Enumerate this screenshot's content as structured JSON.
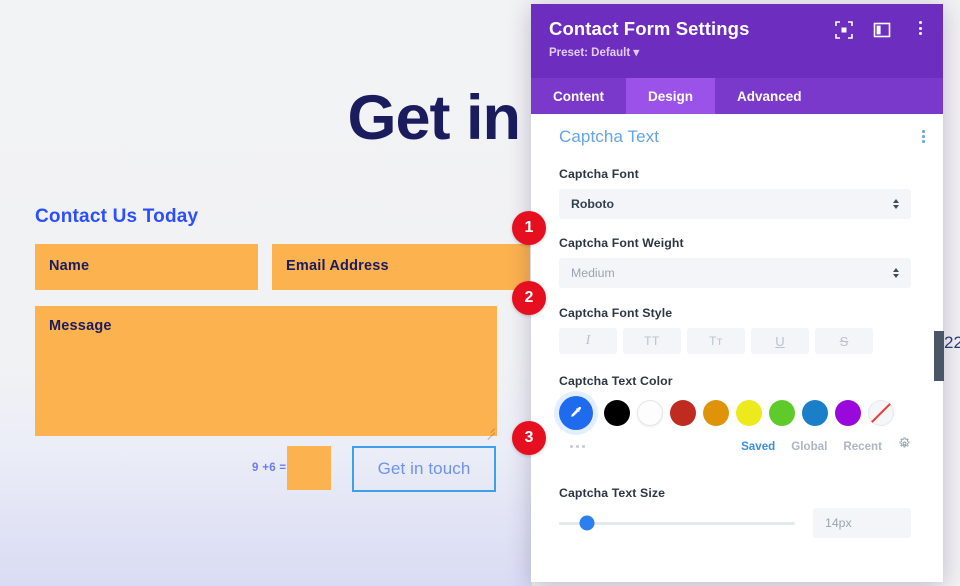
{
  "preview": {
    "hero_heading": "Get in",
    "form_title": "Contact Us Today",
    "fields": {
      "name": "Name",
      "email": "Email Address",
      "message": "Message"
    },
    "captcha": {
      "question": "9 +6 =",
      "answer_value": ""
    },
    "submit_label": "Get in touch",
    "colors": {
      "heading": "#1b1c5e",
      "form_title": "#2b4eff",
      "field_bg": "#fcb24f",
      "captcha_text": "#6b7bf0",
      "button_border": "#3da0e8",
      "button_text": "#6d93ef"
    }
  },
  "settings": {
    "title": "Contact Form Settings",
    "preset": "Preset: Default",
    "header_icons": [
      "focus-icon",
      "layout-icon",
      "more-vertical-icon"
    ],
    "tabs": [
      {
        "label": "Content",
        "active": false
      },
      {
        "label": "Design",
        "active": true
      },
      {
        "label": "Advanced",
        "active": false
      }
    ],
    "section": {
      "heading": "Captcha Text",
      "menu_icon": "more-vertical-icon"
    },
    "font": {
      "label": "Captcha Font",
      "value": "Roboto"
    },
    "font_weight": {
      "label": "Captcha Font Weight",
      "value": "Medium"
    },
    "font_style": {
      "label": "Captcha Font Style",
      "buttons": [
        {
          "name": "italic",
          "glyph": "I"
        },
        {
          "name": "uppercase",
          "glyph": "TT"
        },
        {
          "name": "smallcaps",
          "glyph": "Tᴛ"
        },
        {
          "name": "underline",
          "glyph": "U"
        },
        {
          "name": "strikethrough",
          "glyph": "S"
        }
      ]
    },
    "text_color": {
      "label": "Captcha Text Color",
      "picker_icon": "eyedropper-icon",
      "swatches": [
        {
          "name": "black",
          "hex": "#000000"
        },
        {
          "name": "white",
          "hex": "#ffffff"
        },
        {
          "name": "red",
          "hex": "#bf2b21"
        },
        {
          "name": "orange",
          "hex": "#df9309"
        },
        {
          "name": "yellow",
          "hex": "#ece91c"
        },
        {
          "name": "green",
          "hex": "#5fcb2b"
        },
        {
          "name": "blue",
          "hex": "#1a7fc8"
        },
        {
          "name": "purple",
          "hex": "#9a09db"
        },
        {
          "name": "none",
          "hex": "none"
        }
      ],
      "more_icon": "more-horizontal-icon",
      "tabs": [
        {
          "label": "Saved",
          "active": true
        },
        {
          "label": "Global",
          "active": false
        },
        {
          "label": "Recent",
          "active": false
        }
      ],
      "settings_icon": "gear-icon"
    },
    "text_size": {
      "label": "Captcha Text Size",
      "value": "14px",
      "slider_percent": 12
    },
    "colors": {
      "header_bg": "#6d2ec0",
      "tabs_bg": "#7b39cc",
      "active_tab_bg": "#9a52e8",
      "section_heading": "#64a4e8",
      "accent": "#2d7ff0"
    }
  },
  "callouts": [
    {
      "number": "1"
    },
    {
      "number": "2"
    },
    {
      "number": "3"
    }
  ],
  "edge": {
    "number": "22"
  }
}
